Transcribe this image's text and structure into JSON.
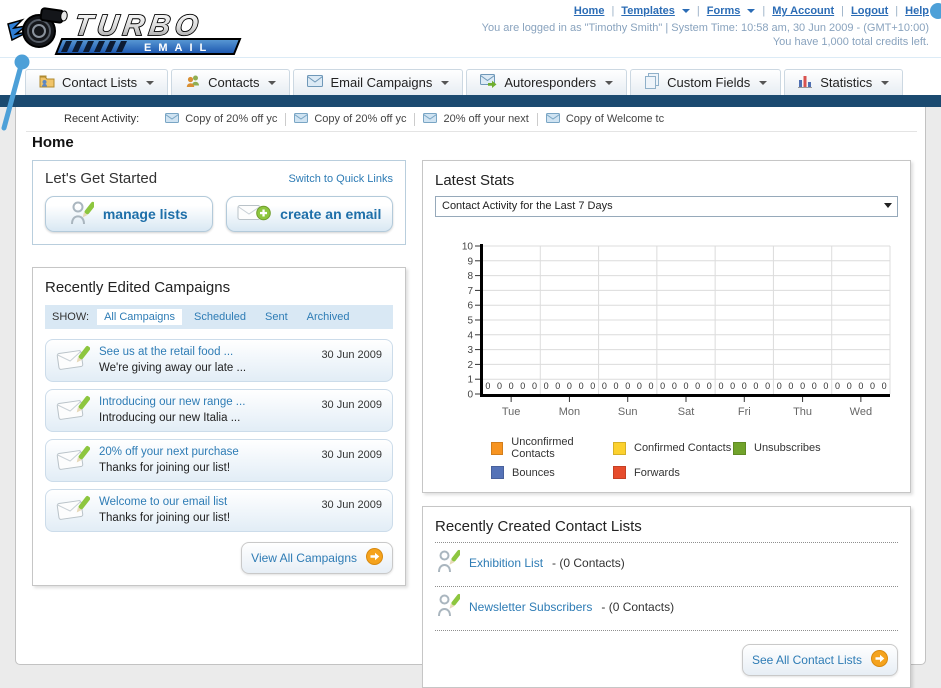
{
  "colors": {
    "accent_blue": "#4da0d8",
    "navy_bar": "#1b4a70",
    "link_blue": "#2e7cb5"
  },
  "header": {
    "logo_title": "TURBO",
    "logo_subtitle": "EMAIL",
    "nav": {
      "home": "Home",
      "templates": "Templates",
      "forms": "Forms",
      "my_account": "My Account",
      "logout": "Logout",
      "help": "Help"
    },
    "login_info": "You are logged in as \"Timothy Smith\" | System Time: 10:58 am, 30 Jun 2009 - (GMT+10:00)",
    "credits_info": "You have 1,000 total credits left."
  },
  "tabs": {
    "contact_lists": "Contact Lists",
    "contacts": "Contacts",
    "email_campaigns": "Email Campaigns",
    "autoresponders": "Autoresponders",
    "custom_fields": "Custom Fields",
    "statistics": "Statistics"
  },
  "recent_activity": {
    "label": "Recent Activity:",
    "items": [
      "Copy of 20% off yc",
      "Copy of 20% off yc",
      "20% off your next ",
      "Copy of Welcome tc"
    ]
  },
  "page_title": "Home",
  "get_started": {
    "title": "Let's Get Started",
    "switch_link": "Switch to Quick Links",
    "manage_lists_label": "manage lists",
    "create_email_label": "create an email"
  },
  "campaigns": {
    "title": "Recently Edited Campaigns",
    "show_label": "SHOW:",
    "filters": {
      "all": "All Campaigns",
      "scheduled": "Scheduled",
      "sent": "Sent",
      "archived": "Archived"
    },
    "items": [
      {
        "title": "See us at the retail food ...",
        "subtitle": "We're giving away our late ...",
        "date": "30 Jun 2009"
      },
      {
        "title": "Introducing our new range ...",
        "subtitle": "Introducing our new Italia ...",
        "date": "30 Jun 2009"
      },
      {
        "title": "20% off your next purchase",
        "subtitle": "Thanks for joining our list!",
        "date": "30 Jun 2009"
      },
      {
        "title": "Welcome to our email list",
        "subtitle": "Thanks for joining our list!",
        "date": "30 Jun 2009"
      }
    ],
    "view_all_label": "View All Campaigns"
  },
  "latest_stats": {
    "title": "Latest Stats",
    "dropdown_value": "Contact Activity for the Last 7 Days"
  },
  "chart_data": {
    "type": "bar",
    "title": "Contact Activity for the Last 7 Days",
    "categories": [
      "Tue",
      "Mon",
      "Sun",
      "Sat",
      "Fri",
      "Thu",
      "Wed"
    ],
    "series": [
      {
        "name": "Unconfirmed Contacts",
        "color": "#f79421",
        "values": [
          0,
          0,
          0,
          0,
          0,
          0,
          0
        ]
      },
      {
        "name": "Confirmed Contacts",
        "color": "#fcd12e",
        "values": [
          0,
          0,
          0,
          0,
          0,
          0,
          0
        ]
      },
      {
        "name": "Unsubscribes",
        "color": "#71a32b",
        "values": [
          0,
          0,
          0,
          0,
          0,
          0,
          0
        ]
      },
      {
        "name": "Bounces",
        "color": "#5573b8",
        "values": [
          0,
          0,
          0,
          0,
          0,
          0,
          0
        ]
      },
      {
        "name": "Forwards",
        "color": "#e74c2c",
        "values": [
          0,
          0,
          0,
          0,
          0,
          0,
          0
        ]
      }
    ],
    "ylim": [
      0,
      10
    ],
    "ytick_step": 1,
    "grid": true,
    "legend_position": "bottom",
    "value_labels_shown": true
  },
  "contact_lists": {
    "title": "Recently Created Contact Lists",
    "items": [
      {
        "name": "Exhibition List",
        "suffix": "- (0 Contacts)"
      },
      {
        "name": "Newsletter Subscribers",
        "suffix": "- (0 Contacts)"
      }
    ],
    "see_all_label": "See All Contact Lists"
  }
}
